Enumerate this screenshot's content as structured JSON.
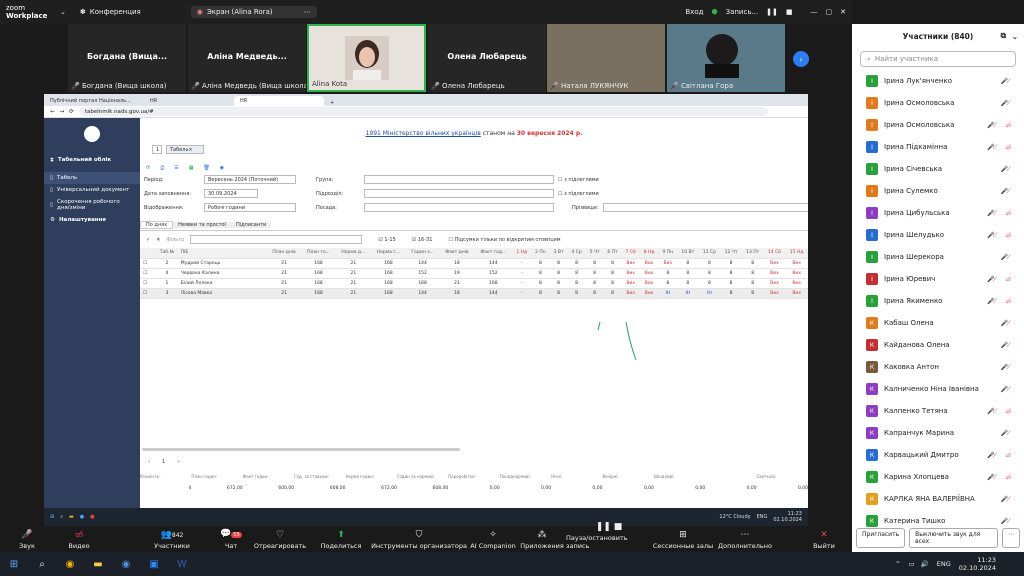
{
  "zoom": {
    "logo_line1": "zoom",
    "logo_line2": "Workplace",
    "conference": "Конференция",
    "screen_label": "Экран (Alina Rora)",
    "entry": "Вход",
    "recording": "Запись..."
  },
  "video_tiles": [
    {
      "name": "Богдана (Вища...",
      "label": "Богдана (Вища школа)"
    },
    {
      "name": "Аліна Медведь...",
      "label": "Аліна Медведь (Вища школа)"
    },
    {
      "name": "",
      "label": "Alina Kota"
    },
    {
      "name": "Олена Любарець",
      "label": "Олена Любарець"
    },
    {
      "name": "",
      "label": "Наталя ЛУКЯНЧУК"
    },
    {
      "name": "",
      "label": "Світлана Гора"
    }
  ],
  "participants": {
    "title": "Участники (840)",
    "search": "Найти участника",
    "invite": "Пригласить",
    "mute_all": "Выключить звук для всех",
    "list": [
      {
        "n": "Ірина Лук'янченко",
        "i": "І",
        "c": "#2aa03a"
      },
      {
        "n": "Ірина Осмоловська",
        "i": "І",
        "c": "#e07a1e"
      },
      {
        "n": "Ірина Осмоловська",
        "i": "І",
        "c": "#e07a1e"
      },
      {
        "n": "Ірина Підкамінна",
        "i": "І",
        "c": "#2a6bd0"
      },
      {
        "n": "Ірина Січевська",
        "i": "І",
        "c": "#2aa03a"
      },
      {
        "n": "Ірина Сулемко",
        "i": "І",
        "c": "#e07a1e"
      },
      {
        "n": "Ірина Цибульська",
        "i": "І",
        "c": "#8e3cc0"
      },
      {
        "n": "Ірина Шелудько",
        "i": "І",
        "c": "#2a6bd0"
      },
      {
        "n": "Ірина Шерекора",
        "i": "І",
        "c": "#2aa03a"
      },
      {
        "n": "Ірина Юревич",
        "i": "І",
        "c": "#c03030"
      },
      {
        "n": "Ірина Якименко",
        "i": "І",
        "c": "#2aa03a"
      },
      {
        "n": "Кабаш Олена",
        "i": "К",
        "c": "#e07a1e"
      },
      {
        "n": "Кайданова Олена",
        "i": "К",
        "c": "#c03030"
      },
      {
        "n": "Каковка Антон",
        "i": "К",
        "c": "#7a5a3a"
      },
      {
        "n": "Калниченко Ніна Іванівна",
        "i": "К",
        "c": "#8e3cc0"
      },
      {
        "n": "Калпенко Тетяна",
        "i": "К",
        "c": "#8e3cc0"
      },
      {
        "n": "Капранчук Марина",
        "i": "К",
        "c": "#8e3cc0"
      },
      {
        "n": "Карвацький Дмитро",
        "i": "К",
        "c": "#2a6bd0"
      },
      {
        "n": "Карина Хлопцева",
        "i": "К",
        "c": "#2aa03a"
      },
      {
        "n": "КАРЛКА ЯНА ВАЛЕРІЇВНА",
        "i": "К",
        "c": "#e0a020"
      },
      {
        "n": "Катерина Тишко",
        "i": "К",
        "c": "#2aa03a"
      }
    ]
  },
  "browser": {
    "tab1": "Публічний портал Національ...",
    "tab2": "HR",
    "tab3": "HR",
    "url": "tabelnmik.nads.gov.ua/#"
  },
  "sidebar": {
    "title": "Табельний облік",
    "items": [
      "Табель",
      "Універсальний документ",
      "Скорочення робочого дня/зміни",
      "Налаштування"
    ]
  },
  "page": {
    "banner_link": "1991 Міністерство вільних українців",
    "banner_mid": " станом на ",
    "banner_date": "30 вересня 2024 р.",
    "tab_num": "1",
    "tab_name": "Табель",
    "period_label": "Період:",
    "period_value": "Вересень 2024 (Поточний)",
    "date_label": "Дата заповнення:",
    "date_value": "30.09.2024",
    "display_label": "Відображення:",
    "display_value": "Робочі години",
    "group_label": "Група:",
    "subdiv_label": "Підрозділ:",
    "position_label": "Посада:",
    "surname_label": "Прізвище:",
    "sub1": "з підлеглими",
    "sub2": "з підлеглими",
    "tabs": [
      "По днях",
      "Неявки та простої",
      "Підписанти"
    ],
    "filter": "Фільтр",
    "c1": "1-15",
    "c2": "16-31",
    "totals_cb": "Підсумки тільки по відкритим стовпцям",
    "headers": [
      "Таб.№",
      "ПІБ",
      "План днів",
      "План го...",
      "Норма д...",
      "Норма г...",
      "Годин з...",
      "Факт днів",
      "Факт год...",
      "1 Нд",
      "2 Пн",
      "3 Вт",
      "4 Ср",
      "5 Чт",
      "6 Пт",
      "7 Сб",
      "8 Нд",
      "9 Пн",
      "10 Вт",
      "11 Ср",
      "12 Чт",
      "13 Пт",
      "14 Сб",
      "15 Нд"
    ],
    "rows": [
      [
        "2",
        "Мудрий Старець",
        "21",
        "168",
        "21",
        "168",
        "144",
        "18",
        "144",
        "-",
        "8",
        "8",
        "8",
        "8",
        "8",
        "Вих",
        "Вих",
        "Вих",
        "8",
        "8",
        "8",
        "8",
        "Вих",
        "Вих"
      ],
      [
        "4",
        "Червона Калина",
        "21",
        "168",
        "21",
        "168",
        "152",
        "19",
        "152",
        "-",
        "8",
        "8",
        "8",
        "8",
        "8",
        "Вих",
        "Вих",
        "8",
        "8",
        "8",
        "8",
        "8",
        "Вих",
        "Вих"
      ],
      [
        "1",
        "Білий Лелека",
        "21",
        "168",
        "21",
        "168",
        "168",
        "21",
        "168",
        "-",
        "8",
        "8",
        "8",
        "8",
        "8",
        "Вих",
        "Вих",
        "8",
        "8",
        "8",
        "8",
        "8",
        "Вих",
        "Вих"
      ],
      [
        "3",
        "Лісова Мавка",
        "21",
        "168",
        "21",
        "168",
        "144",
        "18",
        "144",
        "-",
        "8",
        "8",
        "8",
        "8",
        "8",
        "Вих",
        "Вих",
        "ІН",
        "ІН",
        "ІН",
        "8",
        "8",
        "Вих",
        "Вих"
      ]
    ],
    "pager": "1",
    "totals_headers": [
      "Кількість:",
      "План годин:",
      "Факт годин:",
      "Год. за ставкою:",
      "Норма годин:",
      "Годин за нормою:",
      "Переробіток:",
      "Понаднормові:",
      "Нічні:",
      "Вечірні:",
      "Шкідливі:",
      "",
      "Святкові:"
    ],
    "totals_values": [
      "4",
      "672,00",
      "600,00",
      "608,00",
      "672,00",
      "608,00",
      "0,00",
      "0,00",
      "0,00",
      "0,00",
      "0,00",
      "0,00",
      "0,00"
    ]
  },
  "win_inner": {
    "weather": "12°C Cloudy",
    "lang": "ENG",
    "time": "11:23",
    "date": "02.10.2024"
  },
  "controls": [
    "Звук",
    "Видео",
    "Участники",
    "Чат",
    "Отреагировать",
    "Поделиться",
    "Инструменты организатора",
    "AI Companion",
    "Приложения",
    "Пауза/остановить запись",
    "Сессионные залы",
    "Дополнительно",
    "Выйти"
  ],
  "counts": {
    "participants": "842",
    "chat": "55"
  },
  "taskbar": {
    "lang": "ENG",
    "time": "11:23",
    "date": "02.10.2024"
  }
}
